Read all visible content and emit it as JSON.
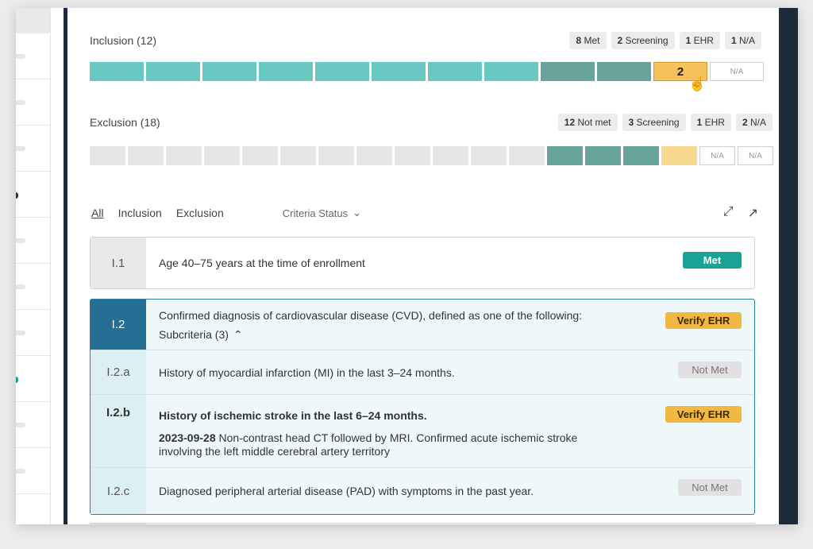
{
  "inclusion": {
    "title": "Inclusion (12)",
    "counts": [
      {
        "n": "8",
        "label": "Met"
      },
      {
        "n": "2",
        "label": "Screening"
      },
      {
        "n": "1",
        "label": "EHR"
      },
      {
        "n": "1",
        "label": "N/A"
      }
    ],
    "ehr_segment_label": "2",
    "na_label": "N/A"
  },
  "exclusion": {
    "title": "Exclusion (18)",
    "counts": [
      {
        "n": "12",
        "label": "Not met"
      },
      {
        "n": "3",
        "label": "Screening"
      },
      {
        "n": "1",
        "label": "EHR"
      },
      {
        "n": "2",
        "label": "N/A"
      }
    ],
    "na_label": "N/A"
  },
  "filters": {
    "all": "All",
    "inclusion": "Inclusion",
    "exclusion": "Exclusion",
    "status": "Criteria Status"
  },
  "criteria": {
    "i1": {
      "id": "I.1",
      "text": "Age 40–75 years at the time of enrollment",
      "status": "Met"
    },
    "i2": {
      "id": "I.2",
      "text": "Confirmed diagnosis of cardiovascular disease (CVD), defined as one of the following:",
      "sub_label": "Subcriteria (3)",
      "status": "Verify EHR"
    },
    "i2a": {
      "id": "I.2.a",
      "text": "History of myocardial infarction (MI) in the last 3–24 months.",
      "status": "Not Met"
    },
    "i2b": {
      "id": "I.2.b",
      "text": "History of ischemic stroke in the last 6–24 months.",
      "date": "2023-09-28",
      "note": "Non-contrast head CT followed by MRI. Confirmed acute ischemic stroke involving the left middle cerebral artery territory",
      "status": "Verify EHR"
    },
    "i2c": {
      "id": "I.2.c",
      "text": "Diagnosed peripheral arterial disease (PAD) with symptoms in the past year.",
      "status": "Not Met"
    }
  },
  "colors": {
    "met": "#6ac8c3",
    "screening": "#69a49c",
    "ehr": "#f4c15a",
    "sidebar_dark": "#1d2a3a",
    "group_border": "#2a7fa8"
  }
}
